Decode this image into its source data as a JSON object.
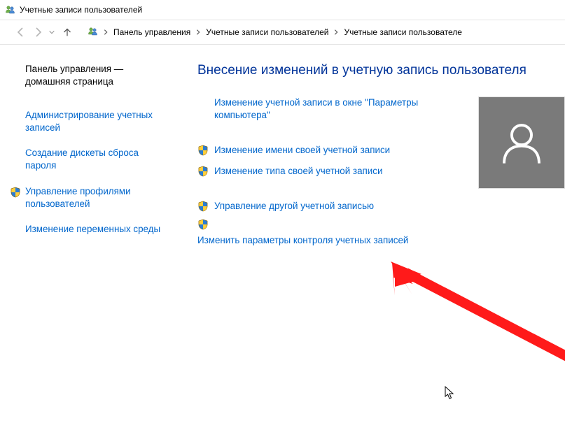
{
  "window": {
    "title": "Учетные записи пользователей"
  },
  "breadcrumbs": {
    "c1": "Панель управления",
    "c2": "Учетные записи пользователей",
    "c3": "Учетные записи пользователе"
  },
  "sidebar": {
    "home": "Панель управления — домашняя страница",
    "links": [
      "Администрирование учетных записей",
      "Создание дискеты сброса пароля",
      "Управление профилями пользователей",
      "Изменение переменных среды"
    ]
  },
  "main": {
    "heading": "Внесение изменений в учетную запись пользователя",
    "link1": "Изменение учетной записи в окне \"Параметры компьютера\"",
    "link2": "Изменение имени своей учетной записи",
    "link3": "Изменение типа своей учетной записи",
    "link4": "Управление другой учетной записью",
    "link5": "Изменить параметры контроля учетных записей"
  }
}
